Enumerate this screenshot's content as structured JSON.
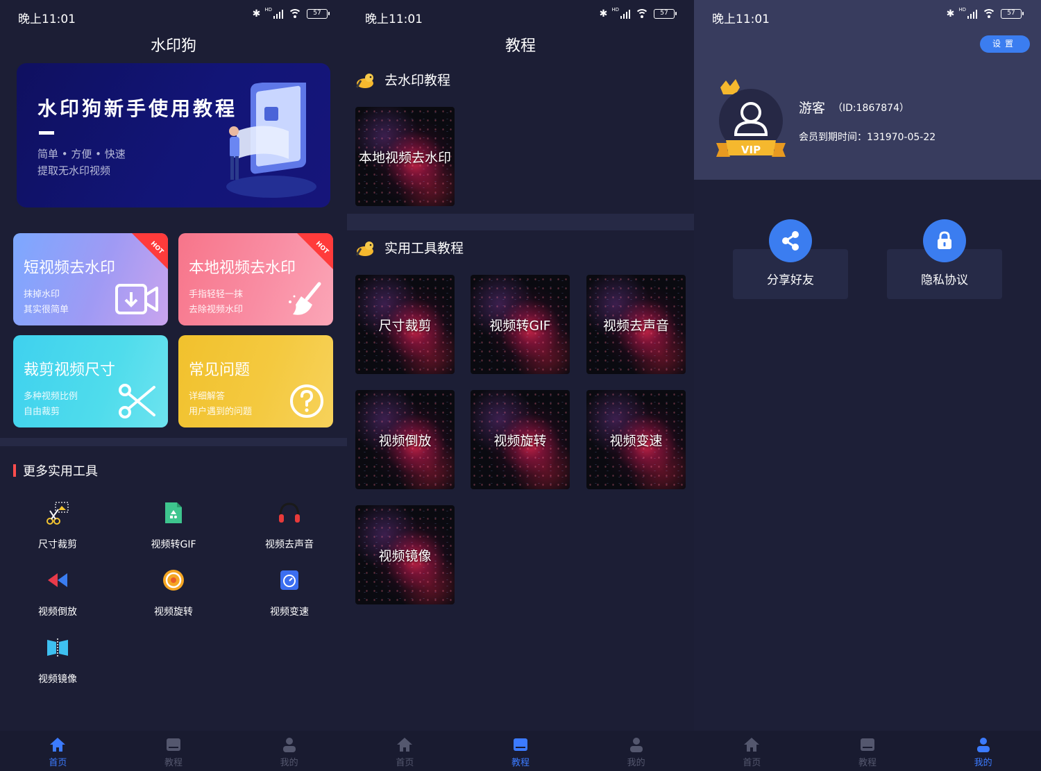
{
  "status_bar": {
    "time": "晚上11:01",
    "battery": "57",
    "network": "HD"
  },
  "screen1": {
    "title": "水印狗",
    "banner": {
      "title": "水印狗新手使用教程",
      "subtitle1": "简单 • 方便 • 快速",
      "subtitle2": "提取无水印视频"
    },
    "cards": [
      {
        "title": "短视频去水印",
        "line1": "抹掉水印",
        "line2": "其实很简单",
        "badge": "HOT",
        "icon": "download-video-icon"
      },
      {
        "title": "本地视频去水印",
        "line1": "手指轻轻一抹",
        "line2": "去除视频水印",
        "badge": "HOT",
        "icon": "broom-icon"
      },
      {
        "title": "裁剪视频尺寸",
        "line1": "多种视频比例",
        "line2": "自由裁剪",
        "icon": "scissors-icon"
      },
      {
        "title": "常见问题",
        "line1": "详细解答",
        "line2": "用户遇到的问题",
        "icon": "question-icon"
      }
    ],
    "more_tools": {
      "heading": "更多实用工具",
      "items": [
        {
          "label": "尺寸裁剪",
          "icon": "crop-scissors-icon"
        },
        {
          "label": "视频转GIF",
          "icon": "gif-file-icon"
        },
        {
          "label": "视频去声音",
          "icon": "headphones-icon"
        },
        {
          "label": "视频倒放",
          "icon": "rewind-icon"
        },
        {
          "label": "视频旋转",
          "icon": "rotate-disc-icon"
        },
        {
          "label": "视频变速",
          "icon": "speed-dial-icon"
        },
        {
          "label": "视频镜像",
          "icon": "mirror-icon"
        }
      ]
    }
  },
  "screen2": {
    "title": "教程",
    "section1": {
      "heading": "去水印教程",
      "items": [
        "本地视频去水印"
      ]
    },
    "section2": {
      "heading": "实用工具教程",
      "items": [
        "尺寸裁剪",
        "视频转GIF",
        "视频去声音",
        "视频倒放",
        "视频旋转",
        "视频变速",
        "视频镜像"
      ]
    }
  },
  "screen3": {
    "settings_label": "设置",
    "avatar_badge": "VIP",
    "nickname": "游客",
    "user_id": "（ID:1867874）",
    "vip_expiry": "会员到期时间：131970-05-22",
    "actions": [
      {
        "label": "分享好友",
        "icon": "share-icon"
      },
      {
        "label": "隐私协议",
        "icon": "lock-icon"
      }
    ]
  },
  "tabbar": {
    "items": [
      {
        "label": "首页",
        "icon": "home-icon"
      },
      {
        "label": "教程",
        "icon": "book-icon"
      },
      {
        "label": "我的",
        "icon": "user-icon"
      }
    ]
  },
  "colors": {
    "accent": "#3c7bff",
    "background": "#1c1e35",
    "tab_inactive": "#54576e",
    "hot_badge": "#ff3b3b"
  }
}
